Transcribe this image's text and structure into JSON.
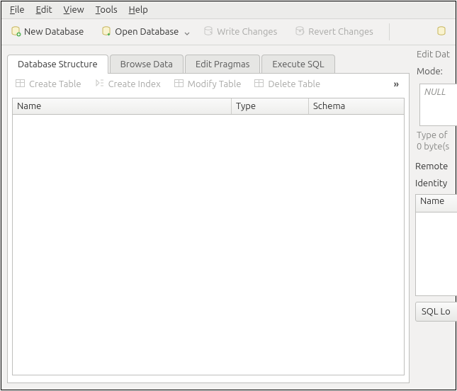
{
  "menu": {
    "items": [
      "File",
      "Edit",
      "View",
      "Tools",
      "Help"
    ]
  },
  "toolbar": {
    "new_db": "New Database",
    "open_db": "Open Database",
    "write_changes": "Write Changes",
    "revert_changes": "Revert Changes"
  },
  "tabs": {
    "structure": "Database Structure",
    "browse": "Browse Data",
    "pragmas": "Edit Pragmas",
    "sql": "Execute SQL"
  },
  "structure_toolbar": {
    "create_table": "Create Table",
    "create_index": "Create Index",
    "modify_table": "Modify Table",
    "delete_table": "Delete Table",
    "overflow": "»"
  },
  "columns": {
    "name": "Name",
    "type": "Type",
    "schema": "Schema"
  },
  "side": {
    "edit_title": "Edit Dat",
    "mode": "Mode:",
    "null": "NULL",
    "type_of": "Type of",
    "bytes": "0 byte(s",
    "remote": "Remote",
    "identity": "Identity",
    "side_name": "Name",
    "sql_log": "SQL Lo"
  }
}
